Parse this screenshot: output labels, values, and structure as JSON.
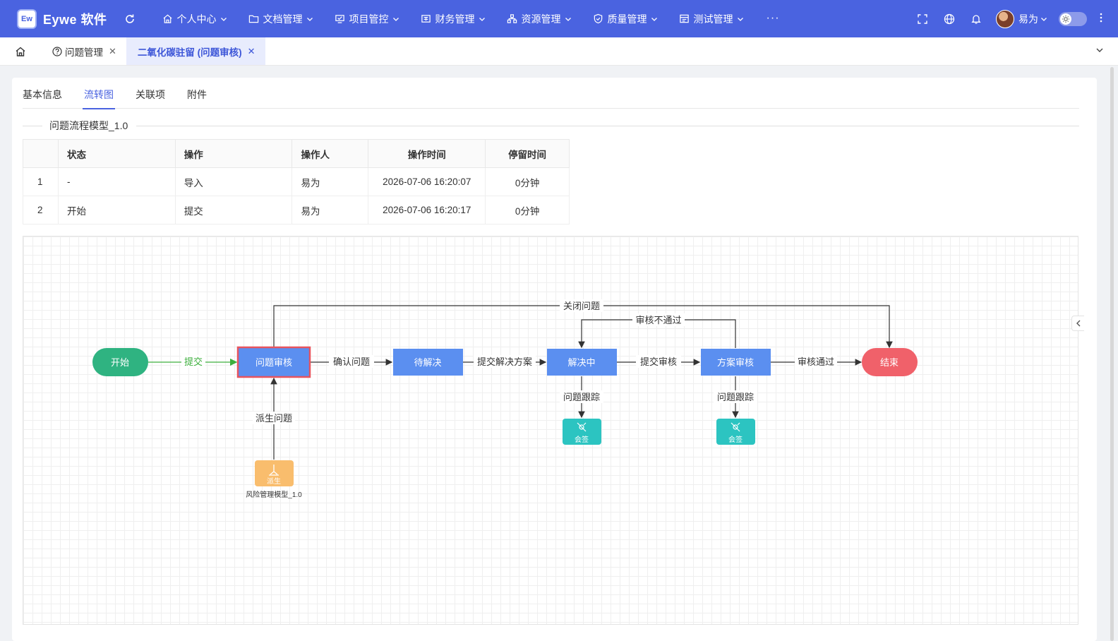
{
  "app": {
    "logo_text": "Ew",
    "title": "Eywe 软件"
  },
  "menu": [
    {
      "label": "个人中心",
      "icon": "home-icon"
    },
    {
      "label": "文档管理",
      "icon": "folder-icon"
    },
    {
      "label": "项目管控",
      "icon": "project-icon"
    },
    {
      "label": "财务管理",
      "icon": "finance-icon"
    },
    {
      "label": "资源管理",
      "icon": "resource-icon"
    },
    {
      "label": "质量管理",
      "icon": "shield-icon"
    },
    {
      "label": "测试管理",
      "icon": "test-icon"
    }
  ],
  "menu_more": "···",
  "user": {
    "name": "易为"
  },
  "tabs": {
    "items": [
      {
        "label": "问题管理",
        "icon": "question-icon",
        "active": false
      },
      {
        "label": "二氧化碳驻留 (问题审核)",
        "active": true
      }
    ],
    "close_glyph": "✕"
  },
  "subtabs": [
    "基本信息",
    "流转图",
    "关联项",
    "附件"
  ],
  "active_subtab": 1,
  "section_title": "问题流程模型_1.0",
  "table": {
    "headers": [
      "",
      "状态",
      "操作",
      "操作人",
      "操作时间",
      "停留时间"
    ],
    "rows": [
      [
        "1",
        "-",
        "导入",
        "易为",
        "2026-07-06 16:20:07",
        "0分钟"
      ],
      [
        "2",
        "开始",
        "提交",
        "易为",
        "2026-07-06 16:20:17",
        "0分钟"
      ]
    ]
  },
  "flow": {
    "nodes": {
      "start": "开始",
      "review": "问题审核",
      "pending": "待解决",
      "solving": "解决中",
      "plan_review": "方案审核",
      "end": "结束",
      "countersign1": "会签",
      "countersign2": "会签",
      "derive": "派生",
      "derive_caption": "风险管理模型_1.0"
    },
    "edges": {
      "submit": "提交",
      "confirm": "确认问题",
      "submit_plan": "提交解决方案",
      "submit_review": "提交审核",
      "approve": "审核通过",
      "close": "关闭问题",
      "reject": "审核不通过",
      "track1": "问题跟踪",
      "track2": "问题跟踪",
      "derived": "派生问题"
    }
  },
  "colors": {
    "primary": "#4a63e0",
    "node_blue": "#5b8ff0",
    "start_green": "#2fb381",
    "end_red": "#f0616a",
    "highlight_border": "#e8545e",
    "countersign_teal": "#2cc4c1",
    "derive_orange": "#f9bd6d",
    "submit_green": "#3daf3d"
  }
}
